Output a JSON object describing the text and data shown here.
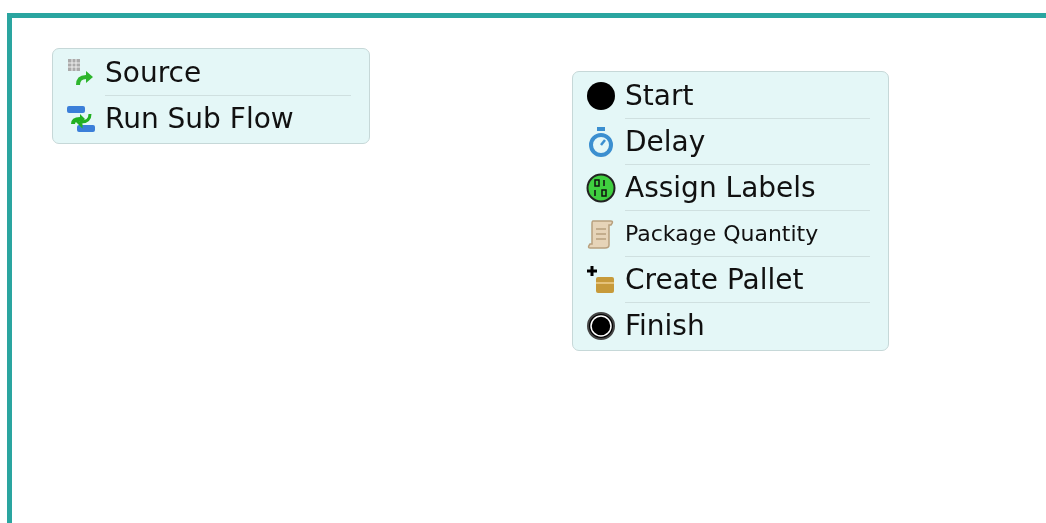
{
  "blocks": [
    {
      "activities": [
        {
          "kind": "source",
          "label": "Source"
        },
        {
          "kind": "subflow",
          "label": "Run Sub Flow"
        }
      ]
    },
    {
      "activities": [
        {
          "kind": "start",
          "label": "Start"
        },
        {
          "kind": "delay",
          "label": "Delay"
        },
        {
          "kind": "assign",
          "label": "Assign Labels"
        },
        {
          "kind": "code",
          "label": "Package Quantity"
        },
        {
          "kind": "create",
          "label": "Create Pallet"
        },
        {
          "kind": "finish",
          "label": "Finish"
        }
      ]
    }
  ]
}
